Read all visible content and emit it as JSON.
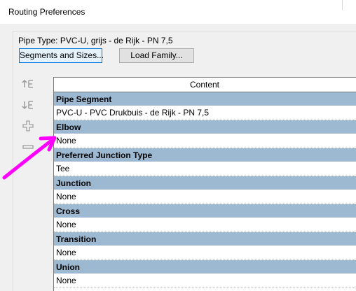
{
  "window": {
    "title": "Routing Preferences"
  },
  "pipe_type": {
    "label": "Pipe Type: PVC-U, grijs - de Rijk - PN 7,5"
  },
  "buttons": {
    "segments_and_sizes": "Segments and Sizes...",
    "load_family": "Load Family..."
  },
  "side_tools": [
    {
      "icon": "move-up-icon"
    },
    {
      "icon": "move-down-icon"
    },
    {
      "icon": "add-row-icon"
    },
    {
      "icon": "remove-row-icon"
    }
  ],
  "grid": {
    "column_header": "Content",
    "rows": [
      {
        "category": "Pipe Segment",
        "value": "PVC-U - PVC Drukbuis - de Rijk - PN 7,5"
      },
      {
        "category": "Elbow",
        "value": "None"
      },
      {
        "category": "Preferred Junction Type",
        "value": "Tee"
      },
      {
        "category": "Junction",
        "value": "None"
      },
      {
        "category": "Cross",
        "value": "None"
      },
      {
        "category": "Transition",
        "value": "None"
      },
      {
        "category": "Union",
        "value": "None"
      }
    ]
  },
  "colors": {
    "category_row": "#9db9d2",
    "annotation_arrow": "#ff00ff",
    "focused_button_border": "#0078d7"
  }
}
